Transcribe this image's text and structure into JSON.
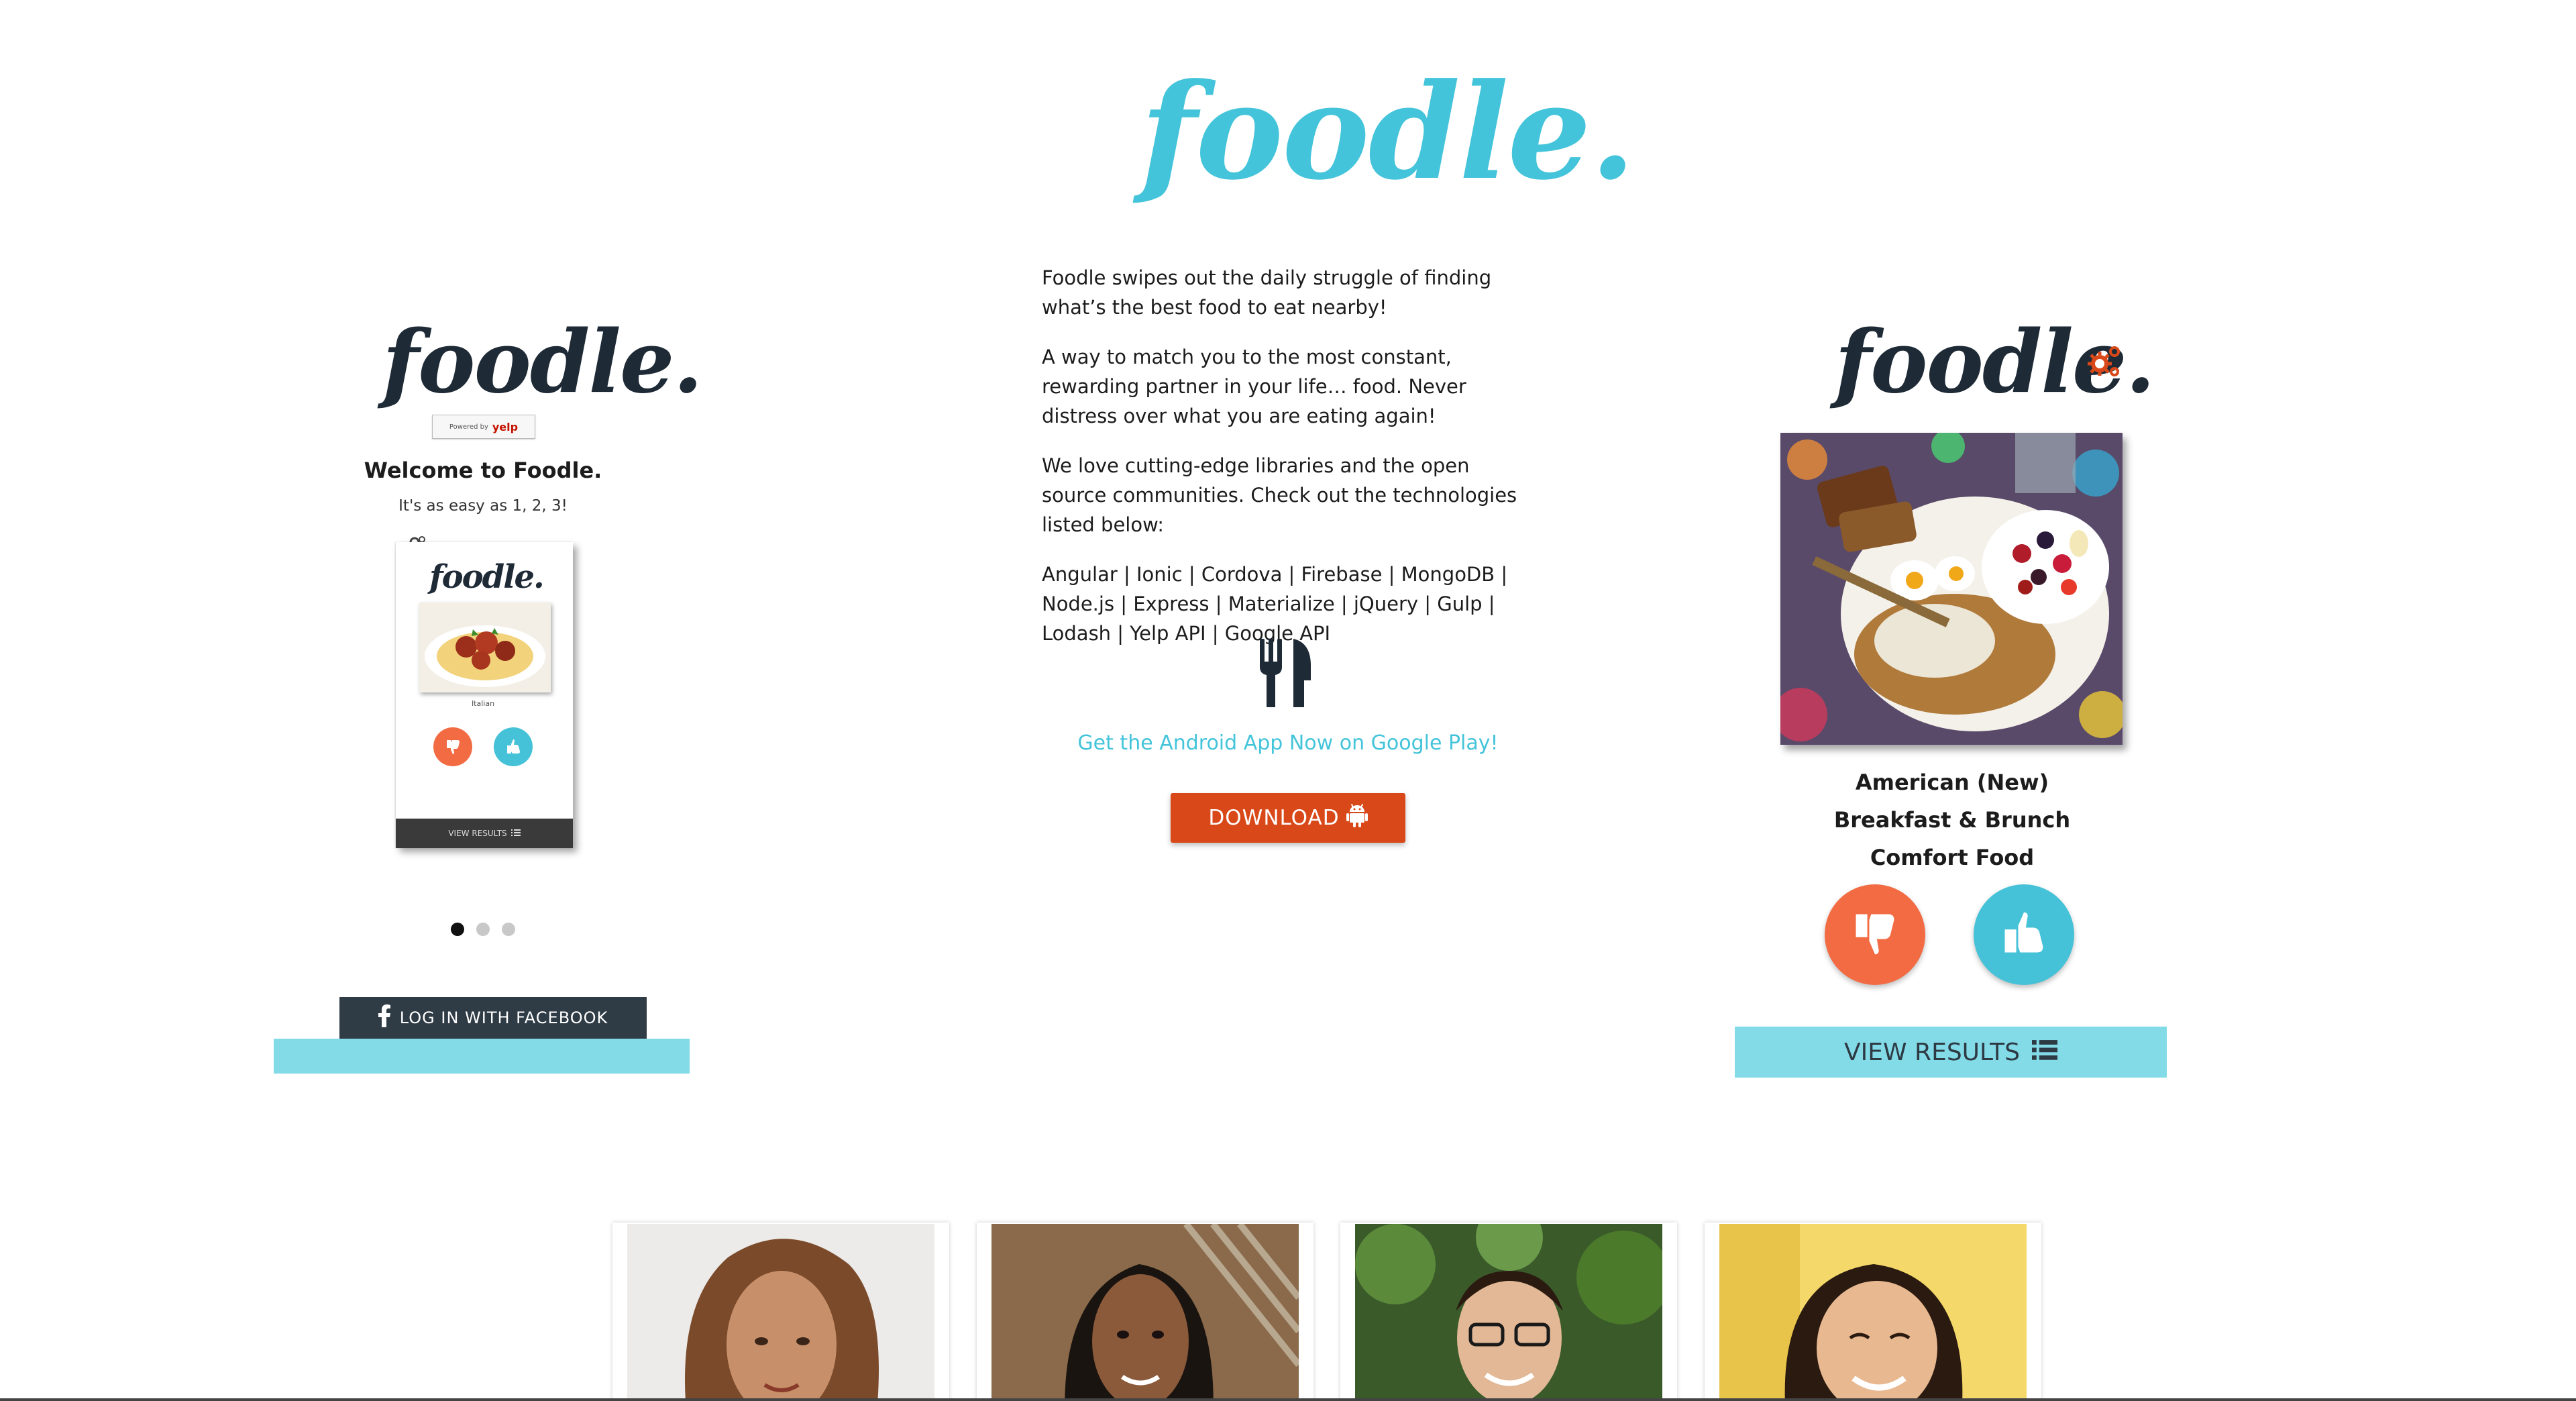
{
  "brand": {
    "logo_text": "foodle.",
    "colors": {
      "teal": "#44c4da",
      "dark": "#1e2a36",
      "orange": "#f26b43",
      "download_red": "#d84818",
      "results_bar": "#83dbe8"
    }
  },
  "intro": {
    "paragraph_1": "Foodle swipes out the daily struggle of finding what’s the best food to eat nearby!",
    "paragraph_2": "A way to match you to the most constant, rewarding partner in your life… food. Never distress over what you are eating again!",
    "paragraph_3": "We love cutting-edge libraries and the open source communities. Check out the technologies listed below:",
    "technologies": "Angular | Ionic | Cordova | Firebase | MongoDB | Node.js | Express | Materialize | jQuery | Gulp | Lodash | Yelp API | Google API",
    "icon": "fork-knife-icon"
  },
  "android": {
    "link_text": "Get the Android App Now on Google Play!",
    "download_label": "DOWNLOAD",
    "download_icon": "android-icon"
  },
  "left_mock": {
    "logo_text": "foodle.",
    "yelp_badge": {
      "powered_by": "Powered by",
      "yelp": "yelp"
    },
    "welcome_title": "Welcome to Foodle.",
    "welcome_subtitle": "It's as easy as 1, 2, 3!",
    "mini_phone": {
      "logo_text": "foodle.",
      "caption": "Italian",
      "results_label": "VIEW RESULTS"
    },
    "carousel_dots": 3,
    "carousel_active": 1,
    "facebook_button": "LOG IN WITH FACEBOOK"
  },
  "right_card": {
    "logo_text": "foodle.",
    "settings_icon": "gears-icon",
    "categories": [
      "American (New)",
      "Breakfast & Brunch",
      "Comfort Food"
    ],
    "dislike_icon": "thumbs-down-icon",
    "like_icon": "thumbs-up-icon",
    "view_results": "VIEW RESULTS",
    "view_results_icon": "list-icon"
  },
  "team": {
    "members": [
      {
        "photo": "team-member-photo-1"
      },
      {
        "photo": "team-member-photo-2"
      },
      {
        "photo": "team-member-photo-3"
      },
      {
        "photo": "team-member-photo-4"
      }
    ]
  }
}
